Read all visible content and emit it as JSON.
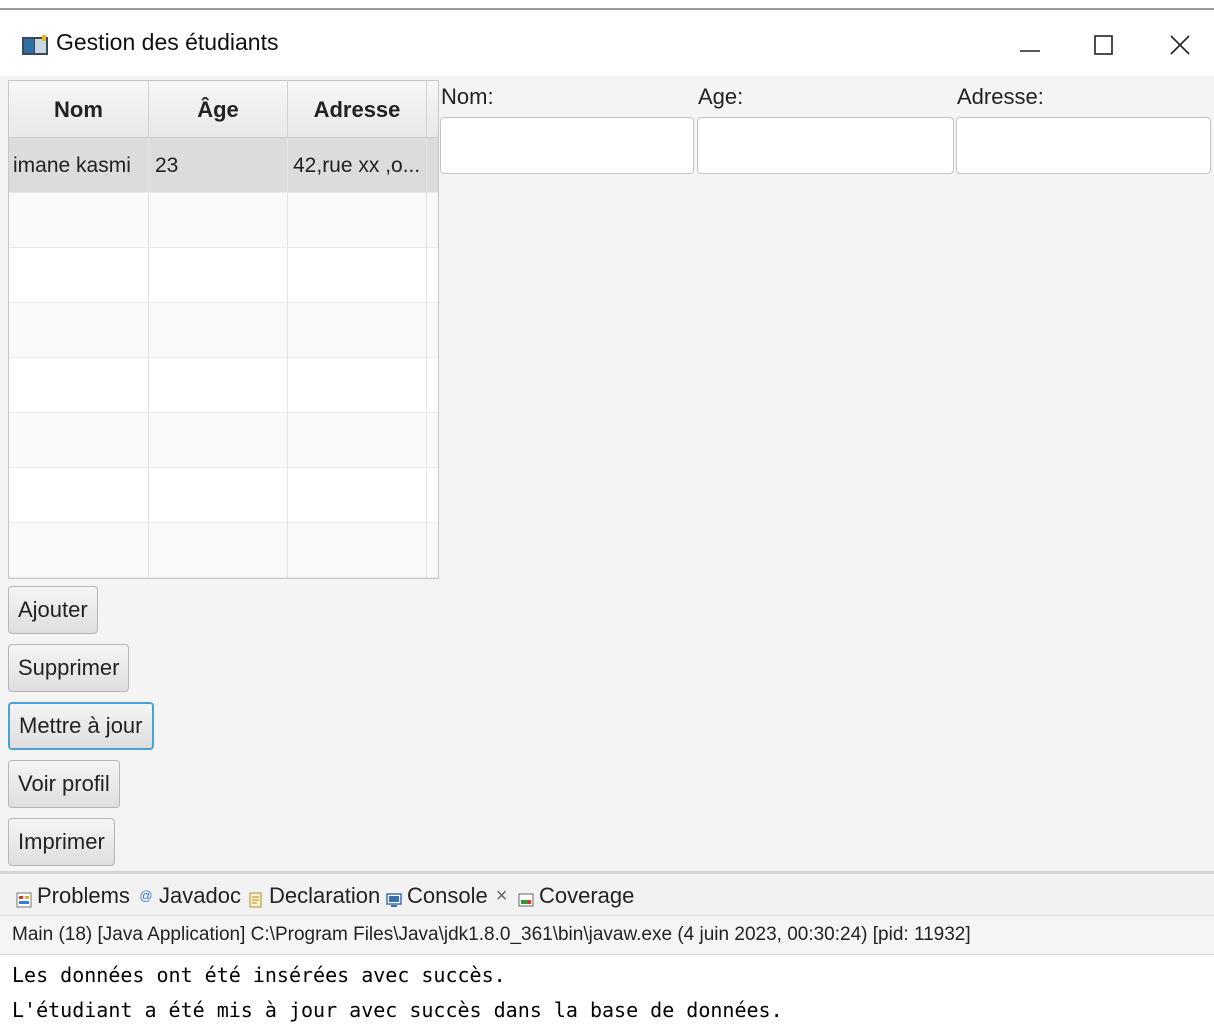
{
  "window": {
    "title": "Gestion des étudiants",
    "controls": {
      "minimize": "—",
      "maximize": "☐",
      "close": "✕"
    }
  },
  "table": {
    "columns": [
      "Nom",
      "Âge",
      "Adresse"
    ],
    "rows": [
      {
        "nom": "imane kasmi",
        "age": "23",
        "adresse": "42,rue xx ,o..."
      }
    ]
  },
  "form": {
    "nom_label": "Nom:",
    "age_label": "Age:",
    "adresse_label": "Adresse:",
    "nom_value": "",
    "age_value": "",
    "adresse_value": ""
  },
  "buttons": {
    "ajouter": "Ajouter",
    "supprimer": "Supprimer",
    "mettre_a_jour": "Mettre à jour",
    "voir_profil": "Voir profil",
    "imprimer": "Imprimer"
  },
  "console": {
    "tabs": [
      "Problems",
      "Javadoc",
      "Declaration",
      "Console",
      "Coverage"
    ],
    "tab_close": "×",
    "header": "Main (18) [Java Application] C:\\Program Files\\Java\\jdk1.8.0_361\\bin\\javaw.exe  (4 juin 2023, 00:30:24) [pid: 11932]",
    "lines": [
      "Les données ont été insérées avec succès.",
      "L'étudiant a été mis à jour avec succès dans la base de données."
    ]
  }
}
